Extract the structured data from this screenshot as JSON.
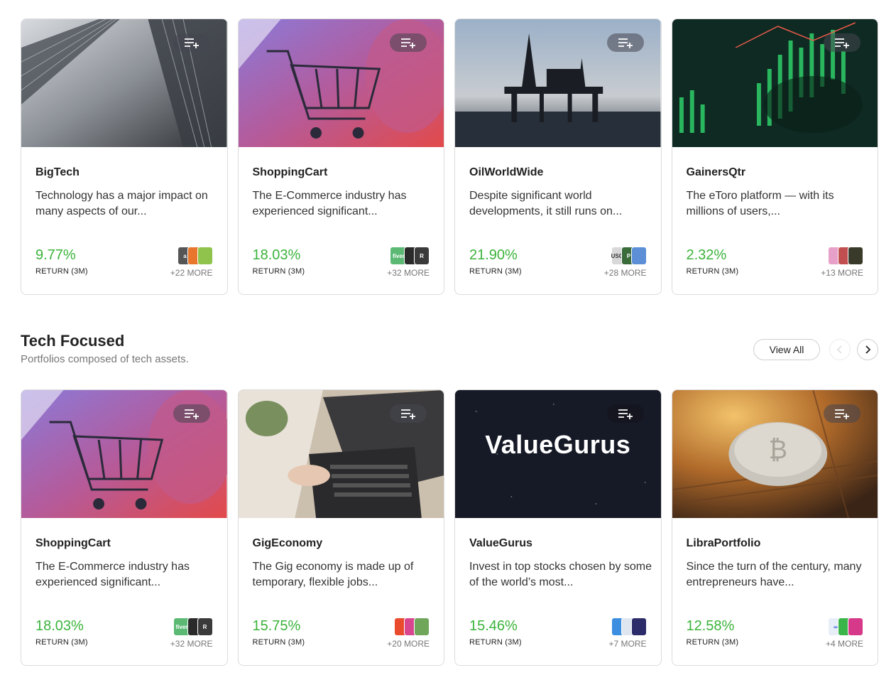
{
  "row1": [
    {
      "title": "BigTech",
      "desc": "Technology has a major impact on many aspects of our...",
      "return": "9.77%",
      "return_label": "RETURN (3M)",
      "more": "+22 MORE",
      "logo_colors": [
        "#555555",
        "#e8762c",
        "#8fc34b"
      ]
    },
    {
      "title": "ShoppingCart",
      "desc": "The E-Commerce industry has experienced significant...",
      "return": "18.03%",
      "return_label": "RETURN (3M)",
      "more": "+32 MORE",
      "logo_colors": [
        "#5bb974",
        "#2a2a2a",
        "#3a3a3a"
      ]
    },
    {
      "title": "OilWorldWide",
      "desc": "Despite significant world developments, it still runs on...",
      "return": "21.90%",
      "return_label": "RETURN (3M)",
      "more": "+28 MORE",
      "logo_colors": [
        "#d8d8d8",
        "#3a6b3a",
        "#5c8fd6"
      ]
    },
    {
      "title": "GainersQtr",
      "desc": "The eToro platform — with its millions of users,...",
      "return": "2.32%",
      "return_label": "RETURN (3M)",
      "more": "+13 MORE",
      "logo_colors": [
        "#e7a0c8",
        "#c14f4f",
        "#3a3a2a"
      ]
    }
  ],
  "section": {
    "title": "Tech Focused",
    "subtitle": "Portfolios composed of tech assets.",
    "view_all": "View All"
  },
  "row2": [
    {
      "title": "ShoppingCart",
      "desc": "The E-Commerce industry has experienced significant...",
      "return": "18.03%",
      "return_label": "RETURN (3M)",
      "more": "+32 MORE",
      "logo_colors": [
        "#5bb974",
        "#2a2a2a",
        "#3a3a3a"
      ]
    },
    {
      "title": "GigEconomy",
      "desc": "The Gig economy is made up of temporary, flexible jobs...",
      "return": "15.75%",
      "return_label": "RETURN (3M)",
      "more": "+20 MORE",
      "logo_colors": [
        "#e94b2c",
        "#d8468f",
        "#6fa65a"
      ]
    },
    {
      "title": "ValueGurus",
      "desc": "Invest in top stocks chosen by some of the world’s most...",
      "return": "15.46%",
      "return_label": "RETURN (3M)",
      "more": "+7 MORE",
      "logo_colors": [
        "#3b8ee0",
        "#dfe6ef",
        "#2c2c6a"
      ]
    },
    {
      "title": "LibraPortfolio",
      "desc": "Since the turn of the century, many entrepreneurs have...",
      "return": "12.58%",
      "return_label": "RETURN (3M)",
      "more": "+4 MORE",
      "logo_colors": [
        "#e8eef8",
        "#39b54a",
        "#d6398a"
      ]
    }
  ],
  "valuegurus_banner": "ValueGurus",
  "icons": {
    "watchlist": "add-to-watchlist-icon",
    "prev": "chevron-left-icon",
    "next": "chevron-right-icon"
  }
}
